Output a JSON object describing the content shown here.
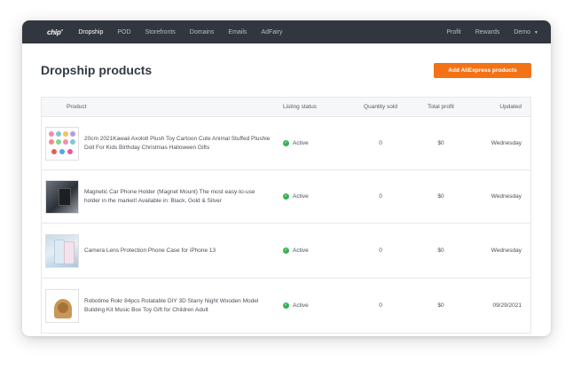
{
  "nav": {
    "logo": "chip'",
    "items": [
      "Dropship",
      "POD",
      "Storefronts",
      "Domains",
      "Emails",
      "AdFairy"
    ],
    "right": [
      "Profit",
      "Rewards",
      "Demo"
    ]
  },
  "page": {
    "title": "Dropship products",
    "add_button": "Add AliExpress products"
  },
  "table": {
    "headers": {
      "product": "Product",
      "status": "Listing status",
      "qty": "Quantity sold",
      "profit": "Total profit",
      "updated": "Updated"
    },
    "rows": [
      {
        "product": "20cm 2021Kawaii Axolotl Plush Toy Cartoon Cute Animal Stuffed Plushie Doll For Kids Birthday Christmas Halloween Gifts",
        "status": "Active",
        "qty": "0",
        "profit": "$0",
        "updated": "Wednesday"
      },
      {
        "product": "Magnetic Car Phone Holder (Magnet Mount) The most easy-to-use holder in the market! Available in: Black, Gold & Silver",
        "status": "Active",
        "qty": "0",
        "profit": "$0",
        "updated": "Wednesday"
      },
      {
        "product": "Camera Lens Protection Phone Case for iPhone 13",
        "status": "Active",
        "qty": "0",
        "profit": "$0",
        "updated": "Wednesday"
      },
      {
        "product": "Robotime Rokr 84pcs Rotatable DIY 3D Starry Night Wooden Model Building Kit Music Box Toy Gift for Children Adult",
        "status": "Active",
        "qty": "0",
        "profit": "$0",
        "updated": "09/29/2021"
      }
    ]
  },
  "colors": {
    "nav_bg": "#32363f",
    "accent": "#f47216",
    "active_dot": "#35b352"
  }
}
